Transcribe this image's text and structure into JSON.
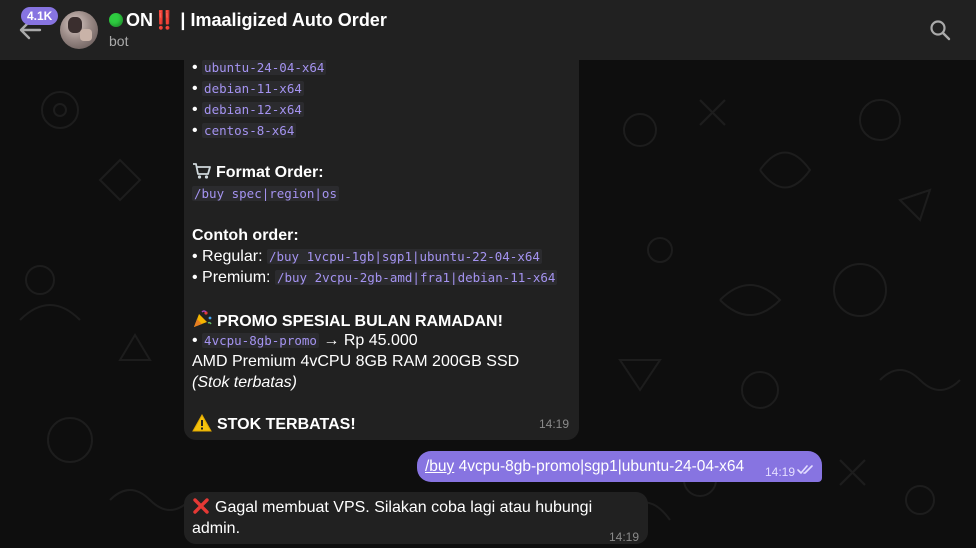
{
  "header": {
    "unread_count": "4.1K",
    "title_status": "ON",
    "title_bangs": "‼️",
    "title_name": " | Imaaligized Auto Order",
    "subtitle": "bot",
    "back_icon": "arrow-left-icon",
    "search_icon": "search-icon"
  },
  "messages": [
    {
      "direction": "incoming",
      "os_list": [
        "ubuntu-24-04-x64",
        "debian-11-x64",
        "debian-12-x64",
        "centos-8-x64"
      ],
      "format_heading": "Format Order:",
      "format_cmd": "/buy spec|region|os",
      "example_heading": "Contoh order:",
      "regular_label": "Regular:",
      "regular_cmd": "/buy 1vcpu-1gb|sgp1|ubuntu-22-04-x64",
      "premium_label": "Premium:",
      "premium_cmd": "/buy 2vcpu-2gb-amd|fra1|debian-11-x64",
      "promo_heading": "PROMO SPESIAL BULAN RAMADAN!",
      "promo_code": "4vcpu-8gb-promo",
      "promo_price": " → Rp 45.000",
      "promo_desc": "AMD Premium 4vCPU 8GB RAM 200GB SSD",
      "promo_note": "(Stok terbatas)",
      "warning": "STOK TERBATAS!",
      "time": "14:19"
    },
    {
      "direction": "outgoing",
      "command": "/buy",
      "text": " 4vcpu-8gb-promo|sgp1|ubuntu-24-04-x64",
      "time": "14:19",
      "status": "read"
    },
    {
      "direction": "incoming",
      "text": "Gagal membuat VPS. Silakan coba lagi atau hubungi admin.",
      "time": "14:19"
    }
  ],
  "colors": {
    "header_bg": "#212121",
    "chat_bg": "#0e0e0e",
    "incoming_bubble": "#212121",
    "outgoing_bubble": "#8774e1",
    "code_text": "#a493f0",
    "badge": "#8774e1"
  }
}
